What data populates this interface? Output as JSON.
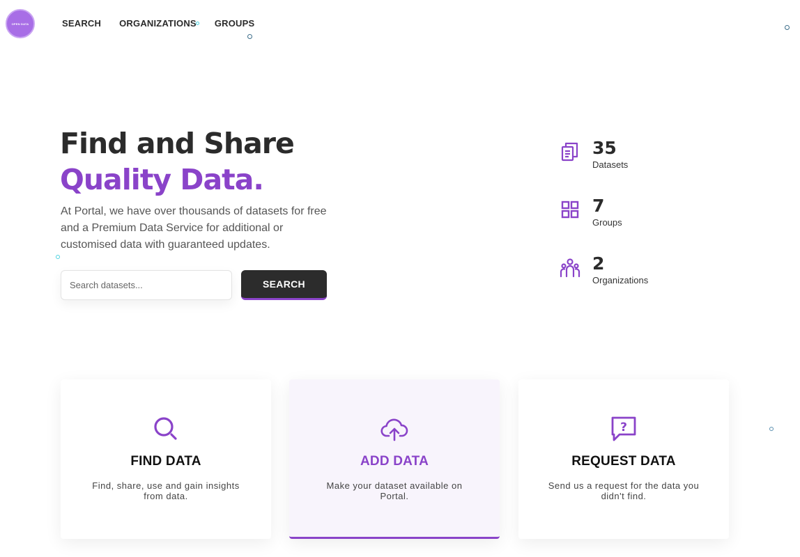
{
  "logo": {
    "text": "OPEN DATA"
  },
  "nav": {
    "items": [
      "SEARCH",
      "ORGANIZATIONS",
      "GROUPS"
    ]
  },
  "hero": {
    "title_line1": "Find and Share",
    "title_line2": "Quality Data.",
    "description": "At Portal, we have over thousands of datasets for free and a Premium Data Service for additional or customised data with guaranteed updates."
  },
  "search": {
    "placeholder": "Search datasets...",
    "value": "",
    "button_label": "SEARCH"
  },
  "stats": [
    {
      "icon": "documents-icon",
      "value": "35",
      "label": "Datasets"
    },
    {
      "icon": "grid-icon",
      "value": "7",
      "label": "Groups"
    },
    {
      "icon": "people-icon",
      "value": "2",
      "label": "Organizations"
    }
  ],
  "cards": [
    {
      "icon": "search-icon",
      "title": "FIND DATA",
      "description": "Find, share, use and gain insights from data."
    },
    {
      "icon": "cloud-upload-icon",
      "title": "ADD DATA",
      "description": "Make your dataset available on Portal."
    },
    {
      "icon": "question-chat-icon",
      "title": "REQUEST DATA",
      "description": "Send us a request for the data you didn't find."
    }
  ],
  "colors": {
    "accent": "#8a43c9",
    "dark": "#2c2c2c",
    "logo": "#a86ee6"
  }
}
